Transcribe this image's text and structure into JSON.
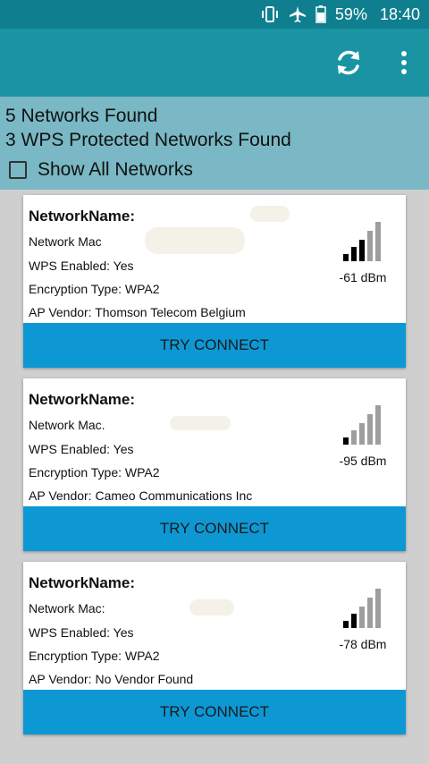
{
  "status_bar": {
    "battery_percent": "59%",
    "time": "18:40"
  },
  "toolbar": {
    "refresh_icon": "refresh-icon",
    "more_icon": "more-vert-icon"
  },
  "summary": {
    "networks_found": "5  Networks Found",
    "wps_found": "3  WPS Protected Networks Found",
    "show_all_label": "Show All Networks",
    "show_all_checked": false
  },
  "networks": [
    {
      "name_label": "NetworkName:",
      "mac_label": "Network Mac",
      "wps": "WPS Enabled: Yes",
      "encryption": "Encryption Type: WPA2",
      "vendor": "AP Vendor: Thomson Telecom Belgium",
      "dbm": "-61 dBm",
      "signal_bars_active": 3,
      "connect_label": "TRY CONNECT"
    },
    {
      "name_label": "NetworkName:",
      "mac_label": "Network Mac.",
      "wps": "WPS Enabled: Yes",
      "encryption": "Encryption Type: WPA2",
      "vendor": "AP Vendor: Cameo Communications Inc",
      "dbm": "-95 dBm",
      "signal_bars_active": 1,
      "connect_label": "TRY CONNECT"
    },
    {
      "name_label": "NetworkName:",
      "mac_label": "Network Mac:",
      "wps": "WPS Enabled: Yes",
      "encryption": "Encryption Type: WPA2",
      "vendor": "AP Vendor: No Vendor Found",
      "dbm": "-78 dBm",
      "signal_bars_active": 2,
      "connect_label": "TRY CONNECT"
    }
  ],
  "colors": {
    "status_bar": "#0f7f8f",
    "toolbar": "#1a93a3",
    "summary_bg": "#79b8c4",
    "button": "#0d98d4",
    "bar_active": "#000000",
    "bar_inactive": "#9e9e9e"
  }
}
